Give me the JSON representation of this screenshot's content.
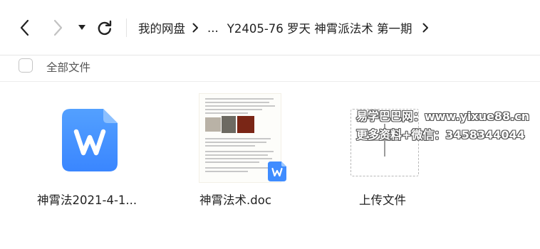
{
  "toolbar": {
    "back_icon": "chevron-left-icon",
    "forward_icon": "chevron-right-icon",
    "dropdown_icon": "caret-down-icon",
    "refresh_icon": "refresh-icon",
    "breadcrumb": {
      "root": "我的网盘",
      "ellipsis": "...",
      "current": "Y2405-76 罗天 神霄派法术 第一期"
    }
  },
  "select_bar": {
    "select_all_label": "全部文件"
  },
  "files": [
    {
      "name": "神霄法2021-4-1...",
      "icon": "wps-writer-icon"
    },
    {
      "name": "神霄法术.doc",
      "icon": "doc-thumbnail"
    }
  ],
  "upload": {
    "label": "上传文件",
    "icon": "plus-icon"
  },
  "watermark": {
    "line1": "易学巴巴网：www.yixue88.cn",
    "line2": "更多资料+微信：3458344044"
  },
  "colors": {
    "wps_blue": "#3f8cff",
    "border": "#e6e6e6"
  }
}
